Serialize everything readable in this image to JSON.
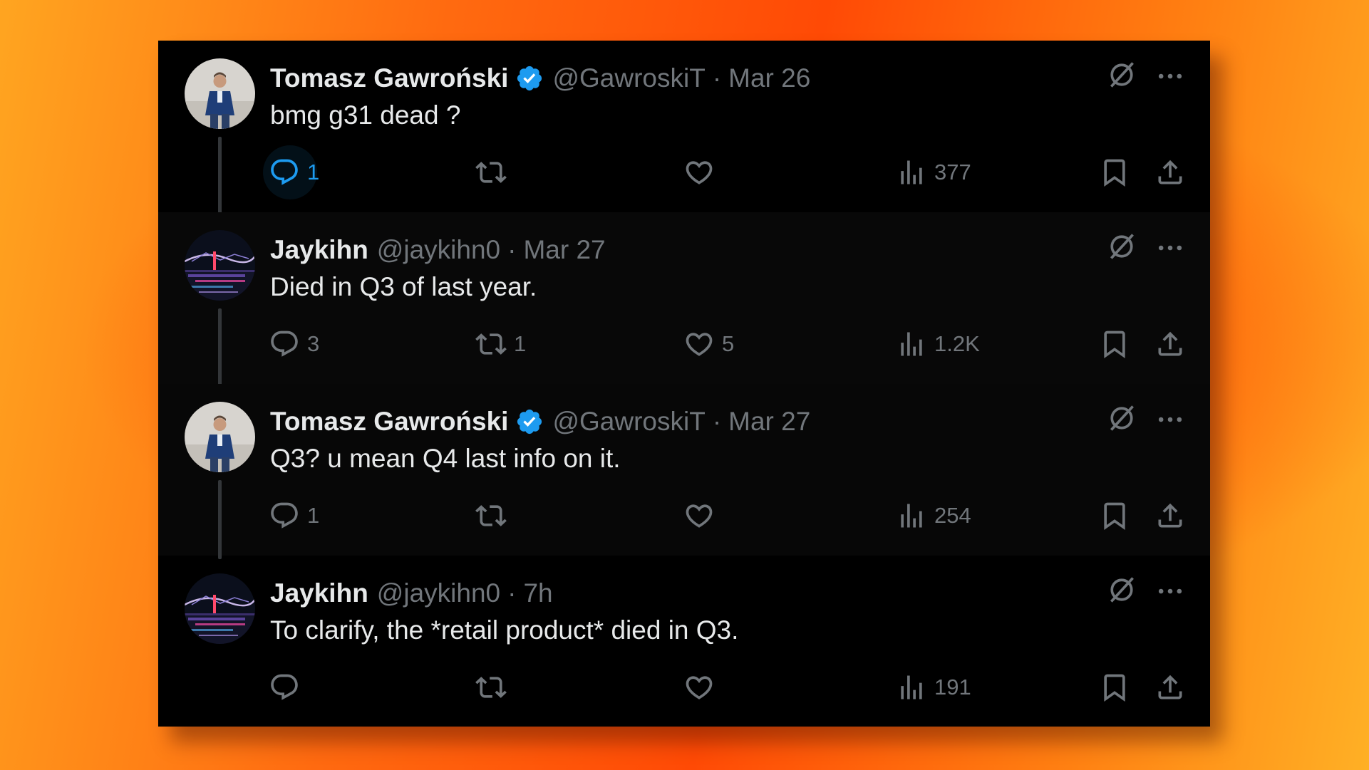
{
  "tweets": [
    {
      "name": "Tomasz Gawroński",
      "verified": true,
      "handle": "@GawroskiT",
      "separator": "·",
      "time": "Mar 26",
      "text": "bmg g31 dead ?",
      "replies": "1",
      "retweets": "",
      "likes": "",
      "views": "377",
      "avatar": "man-in-suit-photo",
      "reply_highlighted": true
    },
    {
      "name": "Jaykihn",
      "verified": false,
      "handle": "@jaykihn0",
      "separator": "·",
      "time": "Mar 27",
      "text": "Died in Q3 of last year.",
      "replies": "3",
      "retweets": "1",
      "likes": "5",
      "views": "1.2K",
      "avatar": "bridge-night-photo"
    },
    {
      "name": "Tomasz Gawroński",
      "verified": true,
      "handle": "@GawroskiT",
      "separator": "·",
      "time": "Mar 27",
      "text": "Q3? u mean Q4 last info on it.",
      "replies": "1",
      "retweets": "",
      "likes": "",
      "views": "254",
      "avatar": "man-in-suit-photo"
    },
    {
      "name": "Jaykihn",
      "verified": false,
      "handle": "@jaykihn0",
      "separator": "·",
      "time": "7h",
      "text": "To clarify, the *retail product* died in Q3.",
      "replies": "",
      "retweets": "",
      "likes": "",
      "views": "191",
      "avatar": "bridge-night-photo"
    }
  ],
  "colors": {
    "background_gradient": [
      "#ffa520",
      "#ff4a05",
      "#ffb025"
    ],
    "card": "#000000",
    "text_primary": "#e7e9ea",
    "text_secondary": "#71767b",
    "accent": "#1d9bf0"
  },
  "icons": [
    "verified-badge-icon",
    "grok-icon",
    "more-icon",
    "reply-icon",
    "retweet-icon",
    "like-icon",
    "views-icon",
    "bookmark-icon",
    "share-icon"
  ]
}
